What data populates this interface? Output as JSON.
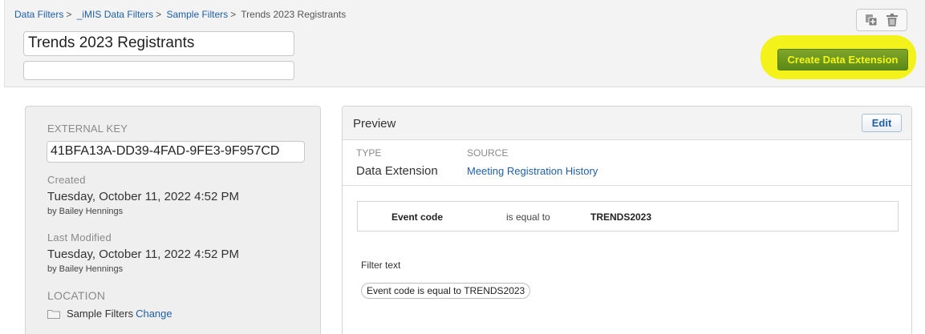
{
  "breadcrumb": {
    "items": [
      "Data Filters",
      "_iMIS Data Filters",
      "Sample Filters"
    ],
    "current": "Trends 2023 Registrants",
    "separator": ">"
  },
  "header": {
    "title_value": "Trends 2023 Registrants",
    "description_value": "",
    "create_button_label": "Create Data Extension",
    "icons": [
      "copy-icon",
      "trash-icon"
    ]
  },
  "details": {
    "external_key_label": "EXTERNAL KEY",
    "external_key_value": "41BFA13A-DD39-4FAD-9FE3-9F957CD",
    "created_label": "Created",
    "created_date": "Tuesday, October 11, 2022 4:52 PM",
    "created_by": "by Bailey Hennings",
    "modified_label": "Last Modified",
    "modified_date": "Tuesday, October 11, 2022 4:52 PM",
    "modified_by": "by Bailey Hennings",
    "location_label": "LOCATION",
    "location_name": "Sample Filters",
    "location_change": "Change"
  },
  "preview": {
    "title": "Preview",
    "edit_label": "Edit",
    "type_label": "TYPE",
    "type_value": "Data Extension",
    "source_label": "SOURCE",
    "source_value": "Meeting Registration History",
    "criteria": {
      "field": "Event code",
      "operator": "is equal to",
      "value": "TRENDS2023"
    },
    "filter_text_label": "Filter text",
    "filter_text_value": "Event code  is equal to  TRENDS2023"
  },
  "colors": {
    "link": "#1f5fa8",
    "create_button": "#5c8a16",
    "highlight": "#f2f20f"
  }
}
